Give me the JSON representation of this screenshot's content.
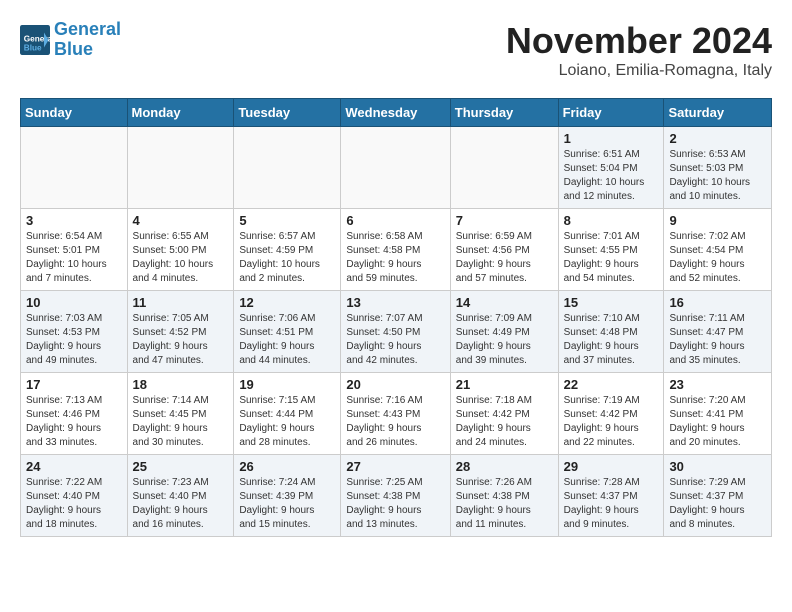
{
  "logo": {
    "line1": "General",
    "line2": "Blue",
    "icon": "▶"
  },
  "title": "November 2024",
  "location": "Loiano, Emilia-Romagna, Italy",
  "weekdays": [
    "Sunday",
    "Monday",
    "Tuesday",
    "Wednesday",
    "Thursday",
    "Friday",
    "Saturday"
  ],
  "weeks": [
    [
      {
        "day": "",
        "info": ""
      },
      {
        "day": "",
        "info": ""
      },
      {
        "day": "",
        "info": ""
      },
      {
        "day": "",
        "info": ""
      },
      {
        "day": "",
        "info": ""
      },
      {
        "day": "1",
        "info": "Sunrise: 6:51 AM\nSunset: 5:04 PM\nDaylight: 10 hours\nand 12 minutes."
      },
      {
        "day": "2",
        "info": "Sunrise: 6:53 AM\nSunset: 5:03 PM\nDaylight: 10 hours\nand 10 minutes."
      }
    ],
    [
      {
        "day": "3",
        "info": "Sunrise: 6:54 AM\nSunset: 5:01 PM\nDaylight: 10 hours\nand 7 minutes."
      },
      {
        "day": "4",
        "info": "Sunrise: 6:55 AM\nSunset: 5:00 PM\nDaylight: 10 hours\nand 4 minutes."
      },
      {
        "day": "5",
        "info": "Sunrise: 6:57 AM\nSunset: 4:59 PM\nDaylight: 10 hours\nand 2 minutes."
      },
      {
        "day": "6",
        "info": "Sunrise: 6:58 AM\nSunset: 4:58 PM\nDaylight: 9 hours\nand 59 minutes."
      },
      {
        "day": "7",
        "info": "Sunrise: 6:59 AM\nSunset: 4:56 PM\nDaylight: 9 hours\nand 57 minutes."
      },
      {
        "day": "8",
        "info": "Sunrise: 7:01 AM\nSunset: 4:55 PM\nDaylight: 9 hours\nand 54 minutes."
      },
      {
        "day": "9",
        "info": "Sunrise: 7:02 AM\nSunset: 4:54 PM\nDaylight: 9 hours\nand 52 minutes."
      }
    ],
    [
      {
        "day": "10",
        "info": "Sunrise: 7:03 AM\nSunset: 4:53 PM\nDaylight: 9 hours\nand 49 minutes."
      },
      {
        "day": "11",
        "info": "Sunrise: 7:05 AM\nSunset: 4:52 PM\nDaylight: 9 hours\nand 47 minutes."
      },
      {
        "day": "12",
        "info": "Sunrise: 7:06 AM\nSunset: 4:51 PM\nDaylight: 9 hours\nand 44 minutes."
      },
      {
        "day": "13",
        "info": "Sunrise: 7:07 AM\nSunset: 4:50 PM\nDaylight: 9 hours\nand 42 minutes."
      },
      {
        "day": "14",
        "info": "Sunrise: 7:09 AM\nSunset: 4:49 PM\nDaylight: 9 hours\nand 39 minutes."
      },
      {
        "day": "15",
        "info": "Sunrise: 7:10 AM\nSunset: 4:48 PM\nDaylight: 9 hours\nand 37 minutes."
      },
      {
        "day": "16",
        "info": "Sunrise: 7:11 AM\nSunset: 4:47 PM\nDaylight: 9 hours\nand 35 minutes."
      }
    ],
    [
      {
        "day": "17",
        "info": "Sunrise: 7:13 AM\nSunset: 4:46 PM\nDaylight: 9 hours\nand 33 minutes."
      },
      {
        "day": "18",
        "info": "Sunrise: 7:14 AM\nSunset: 4:45 PM\nDaylight: 9 hours\nand 30 minutes."
      },
      {
        "day": "19",
        "info": "Sunrise: 7:15 AM\nSunset: 4:44 PM\nDaylight: 9 hours\nand 28 minutes."
      },
      {
        "day": "20",
        "info": "Sunrise: 7:16 AM\nSunset: 4:43 PM\nDaylight: 9 hours\nand 26 minutes."
      },
      {
        "day": "21",
        "info": "Sunrise: 7:18 AM\nSunset: 4:42 PM\nDaylight: 9 hours\nand 24 minutes."
      },
      {
        "day": "22",
        "info": "Sunrise: 7:19 AM\nSunset: 4:42 PM\nDaylight: 9 hours\nand 22 minutes."
      },
      {
        "day": "23",
        "info": "Sunrise: 7:20 AM\nSunset: 4:41 PM\nDaylight: 9 hours\nand 20 minutes."
      }
    ],
    [
      {
        "day": "24",
        "info": "Sunrise: 7:22 AM\nSunset: 4:40 PM\nDaylight: 9 hours\nand 18 minutes."
      },
      {
        "day": "25",
        "info": "Sunrise: 7:23 AM\nSunset: 4:40 PM\nDaylight: 9 hours\nand 16 minutes."
      },
      {
        "day": "26",
        "info": "Sunrise: 7:24 AM\nSunset: 4:39 PM\nDaylight: 9 hours\nand 15 minutes."
      },
      {
        "day": "27",
        "info": "Sunrise: 7:25 AM\nSunset: 4:38 PM\nDaylight: 9 hours\nand 13 minutes."
      },
      {
        "day": "28",
        "info": "Sunrise: 7:26 AM\nSunset: 4:38 PM\nDaylight: 9 hours\nand 11 minutes."
      },
      {
        "day": "29",
        "info": "Sunrise: 7:28 AM\nSunset: 4:37 PM\nDaylight: 9 hours\nand 9 minutes."
      },
      {
        "day": "30",
        "info": "Sunrise: 7:29 AM\nSunset: 4:37 PM\nDaylight: 9 hours\nand 8 minutes."
      }
    ]
  ]
}
